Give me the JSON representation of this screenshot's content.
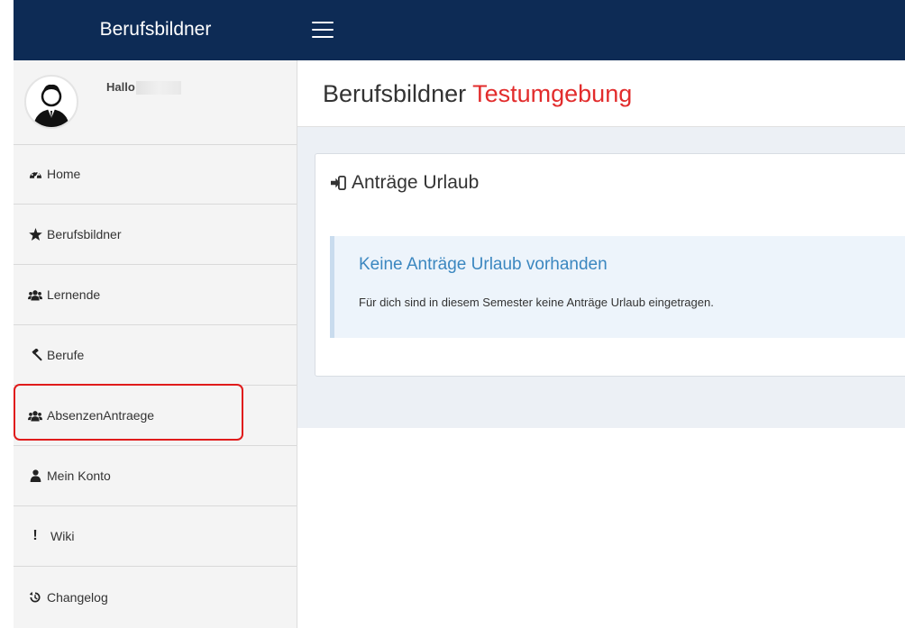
{
  "app": {
    "brand": "Berufsbildner"
  },
  "user": {
    "greeting": "Hallo"
  },
  "sidebar": {
    "items": [
      {
        "label": "Home",
        "icon": "dashboard-icon"
      },
      {
        "label": "Berufsbildner",
        "icon": "star-icon"
      },
      {
        "label": "Lernende",
        "icon": "users-icon"
      },
      {
        "label": "Berufe",
        "icon": "gavel-icon"
      },
      {
        "label": "AbsenzenAntraege",
        "icon": "users-icon",
        "highlighted": true
      },
      {
        "label": "Mein Konto",
        "icon": "user-icon"
      },
      {
        "label": "Wiki",
        "icon": "exclamation-icon"
      },
      {
        "label": "Changelog",
        "icon": "history-icon"
      }
    ]
  },
  "header": {
    "title": "Berufsbildner",
    "title_accent": "Testumgebung"
  },
  "box": {
    "title": "Anträge Urlaub",
    "callout_title": "Keine Anträge Urlaub vorhanden",
    "callout_text": "Für dich sind in diesem Semester keine Anträge Urlaub eingetragen."
  },
  "colors": {
    "topbar": "#0d2b55",
    "accent_red": "#e22c2c",
    "callout_blue": "#3b87c0",
    "highlight_border": "#e01b1b"
  }
}
